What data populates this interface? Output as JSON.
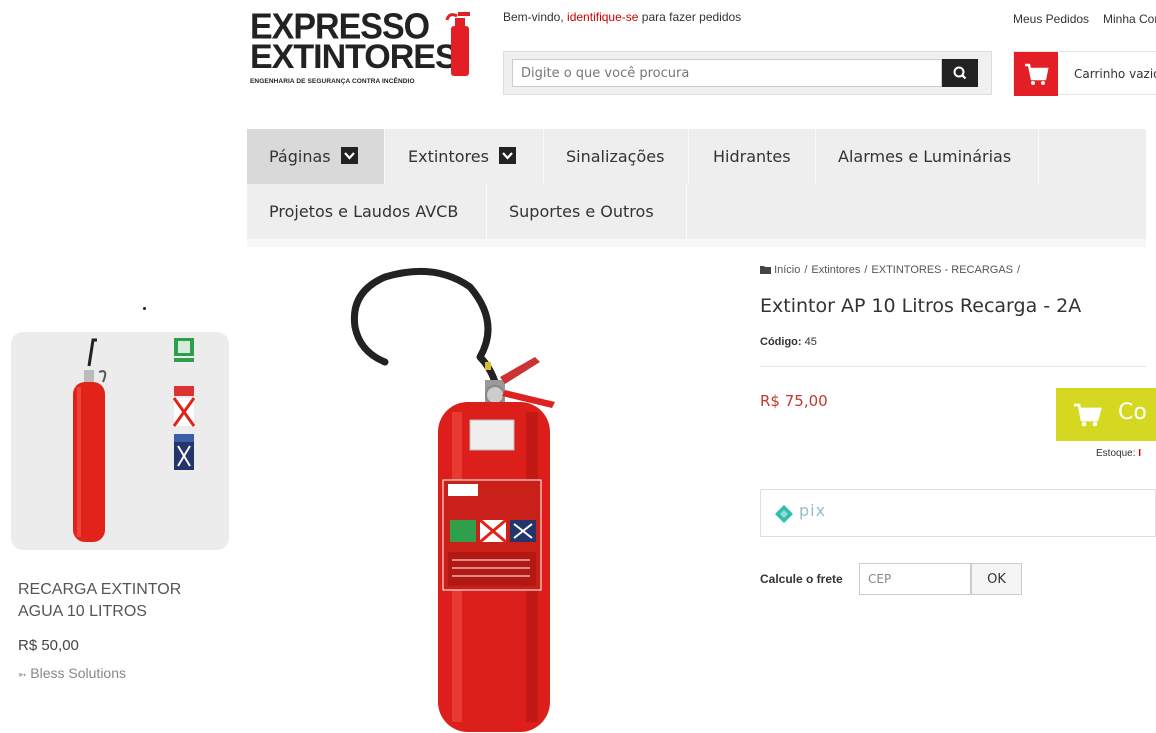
{
  "logo": {
    "line1": "EXPRESSO",
    "line2": "EXTINTORES",
    "tagline": "ENGENHARIA DE SEGURANÇA CONTRA INCÊNDIO"
  },
  "header": {
    "welcome_prefix": "Bem-vindo,",
    "welcome_link": "identifique-se",
    "welcome_suffix": "para fazer pedidos",
    "my_orders": "Meus Pedidos",
    "my_account": "Minha Conta"
  },
  "search": {
    "placeholder": "Digite o que você procura",
    "button_icon": "search-icon"
  },
  "cart": {
    "label": "Carrinho vazio",
    "icon": "cart-icon"
  },
  "nav": {
    "items": [
      {
        "label": "Páginas"
      },
      {
        "label": "Extintores"
      },
      {
        "label": "Sinalizações"
      },
      {
        "label": "Hidrantes"
      },
      {
        "label": "Alarmes e Luminárias"
      },
      {
        "label": "Projetos e Laudos AVCB"
      },
      {
        "label": "Suportes e Outros"
      }
    ]
  },
  "sidebar": {
    "product_title": "RECARGA EXTINTOR AGUA 10 LITROS",
    "product_price": "R$ 50,00",
    "credit": "Bless Solutions"
  },
  "breadcrumb": {
    "items": [
      "Início",
      "Extintores",
      "EXTINTORES - RECARGAS"
    ],
    "separator": "/"
  },
  "product": {
    "title": "Extintor AP 10 Litros Recarga - 2A",
    "code_label": "Código:",
    "code_value": "45",
    "price": "R$ 75,00",
    "buy_label": "Co",
    "stock_label": "Estoque:",
    "stock_value": "I",
    "pix_label": "pix"
  },
  "freight": {
    "label": "Calcule o frete",
    "cep_placeholder": "CEP",
    "ok_label": "OK"
  },
  "colors": {
    "accent_red": "#e31e24",
    "price_red": "#c0392b",
    "buy_green": "#d4d820",
    "nav_bg": "#eeeeee"
  }
}
